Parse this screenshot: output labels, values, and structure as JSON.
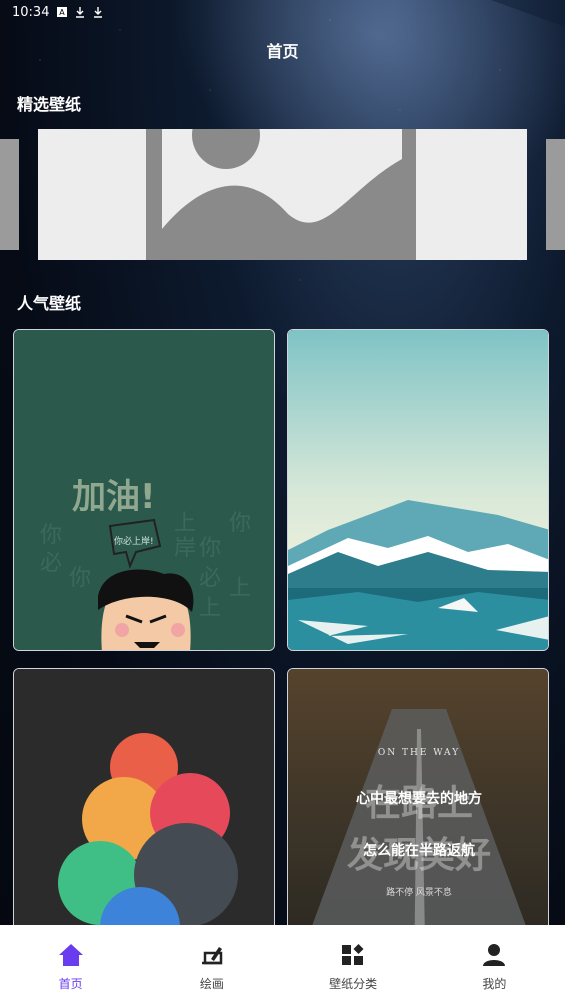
{
  "status_bar": {
    "time": "10:34",
    "icons": [
      "a-icon",
      "download-icon",
      "download-icon"
    ]
  },
  "header": {
    "title": "首页"
  },
  "featured": {
    "title": "精选壁纸"
  },
  "popular": {
    "title": "人气壁纸",
    "card1": {
      "headline": "加油!",
      "bubble": "你必上岸!",
      "words": [
        "你",
        "必",
        "上",
        "岸"
      ]
    },
    "card4": {
      "en": "ON THE WAY",
      "big1": "在路上",
      "line1": "心中最想要去的地方",
      "big2": "发现美好",
      "line2": "怎么能在半路返航",
      "bottom": "路不停 风景不息"
    }
  },
  "nav": {
    "accent": "#6a3cf0",
    "items": [
      {
        "label": "首页",
        "icon": "home-icon"
      },
      {
        "label": "绘画",
        "icon": "draw-icon"
      },
      {
        "label": "壁纸分类",
        "icon": "category-icon"
      },
      {
        "label": "我的",
        "icon": "person-icon"
      }
    ]
  }
}
